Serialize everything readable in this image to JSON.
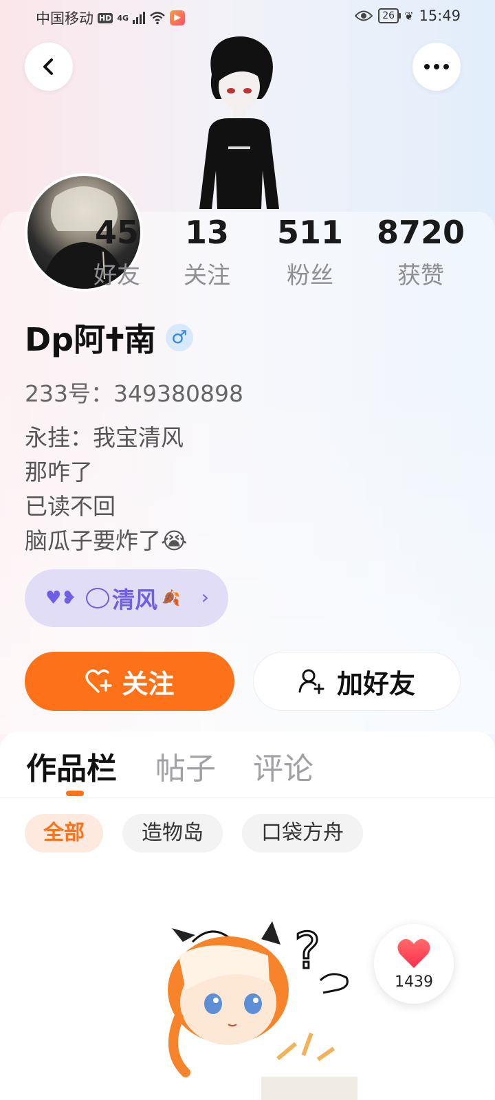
{
  "status_bar": {
    "carrier": "中国移动",
    "hd": "HD",
    "network": "4G",
    "battery": "26",
    "time": "15:49"
  },
  "header": {
    "back_icon": "chevron-left-icon",
    "more_icon": "more-dots-icon"
  },
  "profile": {
    "stats": [
      {
        "value": "45",
        "label": "好友"
      },
      {
        "value": "13",
        "label": "关注"
      },
      {
        "value": "511",
        "label": "粉丝"
      },
      {
        "value": "8720",
        "label": "获赞"
      }
    ],
    "name": "Dp阿🕇南",
    "gender_symbol": "♂",
    "gender_color": "#2f86e8",
    "id_label": "233号：",
    "id_value": "349380898",
    "bio_lines": [
      "永挂：我宝清风",
      "那咋了",
      "已读不回",
      "脑瓜子要炸了😭"
    ],
    "couple_tag": {
      "name": "清风",
      "color": "#6e5fe6"
    }
  },
  "actions": {
    "follow_label": "关注",
    "add_friend_label": "加好友",
    "accent_color": "#fd7119"
  },
  "tabs": [
    {
      "label": "作品栏",
      "active": true
    },
    {
      "label": "帖子",
      "active": false
    },
    {
      "label": "评论",
      "active": false
    }
  ],
  "filters": [
    {
      "label": "全部",
      "active": true
    },
    {
      "label": "造物岛",
      "active": false
    },
    {
      "label": "口袋方舟",
      "active": false
    }
  ],
  "like_float": {
    "count": "1439",
    "icon": "heart-icon"
  }
}
